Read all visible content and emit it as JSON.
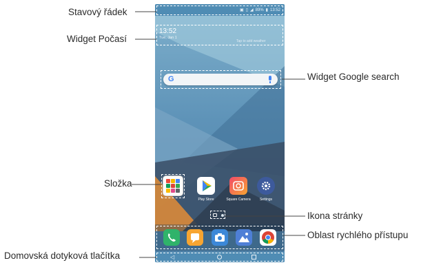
{
  "callouts": {
    "status_bar": "Stavový řádek",
    "weather_widget": "Widget Počasí",
    "google_widget": "Widget Google search",
    "folder": "Složka",
    "page_icon": "Ikona stránky",
    "quick_access": "Oblast rychlého přístupu",
    "home_touch_buttons": "Domovská dotyková tlačítka"
  },
  "phone": {
    "status_bar": {
      "battery": "89%",
      "time": "13:52"
    },
    "weather": {
      "time": "13:52",
      "date": "Tue, Jan 1",
      "hint": "Tap to add weather"
    },
    "search": {
      "logo": "G"
    },
    "apps": [
      {
        "label": "",
        "icon": "folder-icon"
      },
      {
        "label": "Play Store",
        "icon": "play-store-icon"
      },
      {
        "label": "Square Camera",
        "icon": "square-camera-icon"
      },
      {
        "label": "Settings",
        "icon": "gear-icon"
      }
    ],
    "dock": [
      {
        "icon": "phone-icon",
        "color": "#2fb36a"
      },
      {
        "icon": "messages-icon",
        "color": "#f7a531"
      },
      {
        "icon": "camera-icon",
        "color": "#3c88d8"
      },
      {
        "icon": "gallery-icon",
        "color": "#4e7fd6"
      },
      {
        "icon": "chrome-icon",
        "color": "#ffffff"
      }
    ],
    "nav": {
      "back": "◁",
      "home": "○",
      "recent": "□"
    }
  }
}
